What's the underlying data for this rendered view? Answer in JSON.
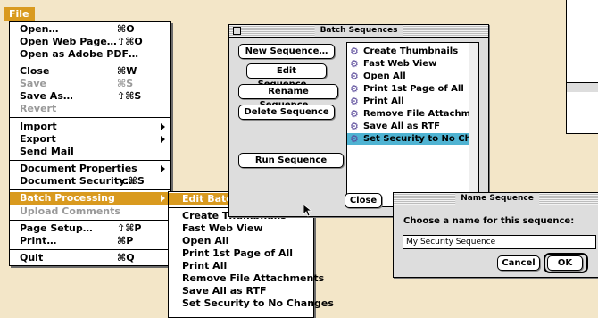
{
  "file_menu": {
    "title": "File",
    "items": [
      {
        "label": "Open…",
        "shortcut": "⌘O"
      },
      {
        "label": "Open Web Page…",
        "shortcut": "⇧⌘O"
      },
      {
        "label": "Open as Adobe PDF…",
        "shortcut": ""
      },
      {
        "label": "Close",
        "shortcut": "⌘W"
      },
      {
        "label": "Save",
        "shortcut": "⌘S"
      },
      {
        "label": "Save As…",
        "shortcut": "⇧⌘S"
      },
      {
        "label": "Revert",
        "shortcut": ""
      },
      {
        "label": "Import",
        "shortcut": ""
      },
      {
        "label": "Export",
        "shortcut": ""
      },
      {
        "label": "Send Mail",
        "shortcut": ""
      },
      {
        "label": "Document Properties",
        "shortcut": ""
      },
      {
        "label": "Document Security…",
        "shortcut": "⌥⌘S"
      },
      {
        "label": "Batch Processing",
        "shortcut": ""
      },
      {
        "label": "Upload Comments",
        "shortcut": ""
      },
      {
        "label": "Page Setup…",
        "shortcut": "⇧⌘P"
      },
      {
        "label": "Print…",
        "shortcut": "⌘P"
      },
      {
        "label": "Quit",
        "shortcut": "⌘Q"
      }
    ]
  },
  "batch_submenu": {
    "items": [
      "Edit Batch Sequences…",
      "Create Thumbnails",
      "Fast Web View",
      "Open All",
      "Print 1st Page of All",
      "Print All",
      "Remove File Attachments",
      "Save All as RTF",
      "Set Security to No Changes"
    ]
  },
  "batch_window": {
    "title": "Batch Sequences",
    "buttons": {
      "new": "New Sequence…",
      "edit": "Edit Sequence…",
      "rename": "Rename Sequence…",
      "delete": "Delete Sequence",
      "run": "Run Sequence",
      "close": "Close"
    },
    "sequences": [
      "Create Thumbnails",
      "Fast Web View",
      "Open All",
      "Print 1st Page of All",
      "Print All",
      "Remove File Attachments",
      "Save All as RTF",
      "Set Security to No Changes"
    ],
    "selected_index": 7
  },
  "name_dialog": {
    "title": "Name Sequence",
    "prompt": "Choose a name for this sequence:",
    "value": "My Security Sequence",
    "cancel": "Cancel",
    "ok": "OK"
  },
  "colors": {
    "menu_highlight": "#d99a1f",
    "list_selection": "#4fb3d2",
    "background": "#f3e6c8"
  }
}
